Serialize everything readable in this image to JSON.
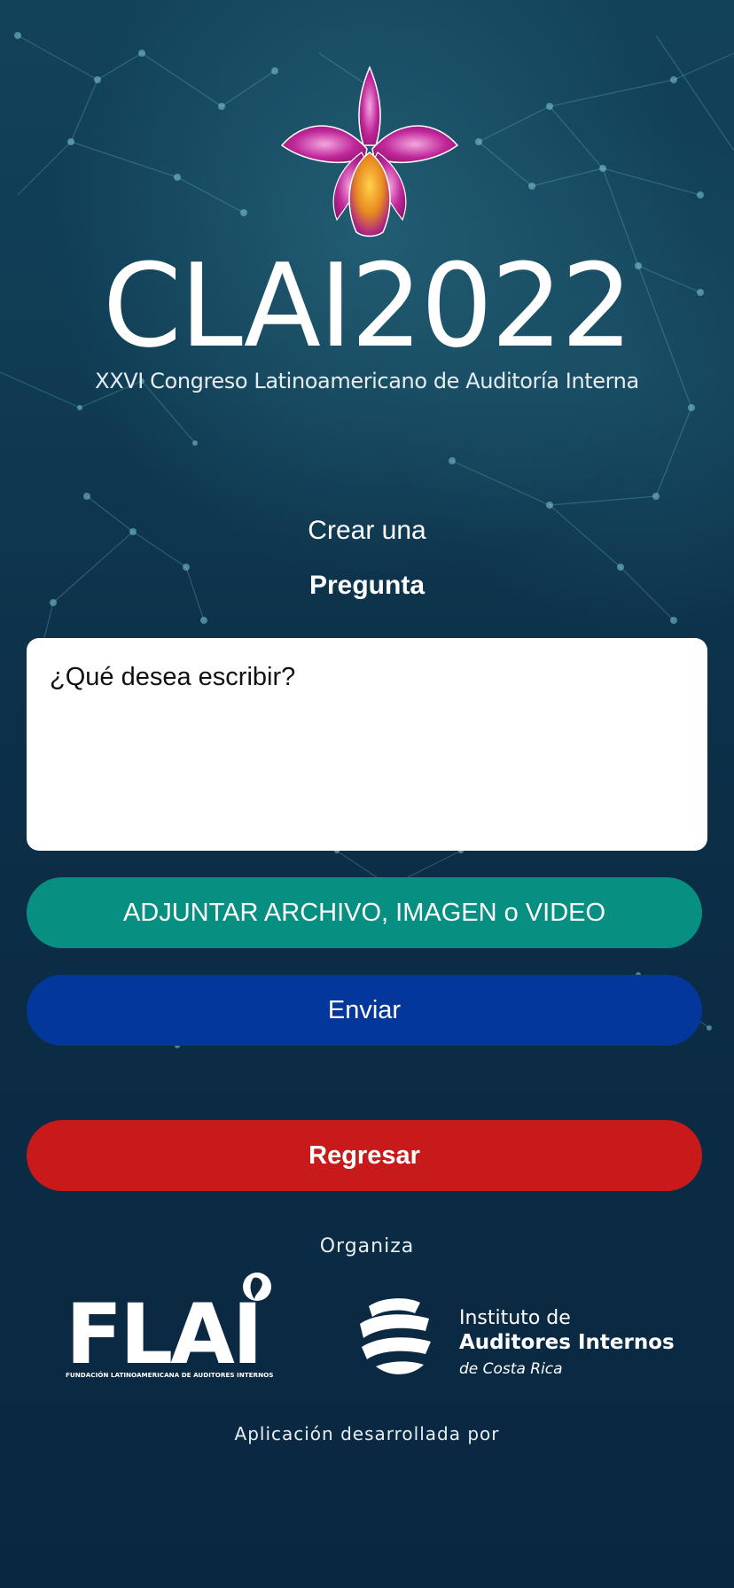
{
  "logo": {
    "title": "CLAI2022",
    "subtitle": "XXVI Congreso Latinoamericano de Auditoría Interna"
  },
  "heading": {
    "line1": "Crear una",
    "line2": "Pregunta"
  },
  "question": {
    "placeholder": "¿Qué desea escribir?",
    "value": ""
  },
  "buttons": {
    "attach_label": "ADJUNTAR ARCHIVO, IMAGEN o VIDEO",
    "send_label": "Enviar",
    "back_label": "Regresar"
  },
  "footer": {
    "organiza": "Organiza",
    "flai_name": "FLAI",
    "flai_full": "FUNDACIÓN LATINOAMERICANA DE AUDITORES INTERNOS",
    "iai_line1": "Instituto de",
    "iai_line2": "Auditores Internos",
    "iai_line3": "de Costa Rica",
    "developed_by": "Aplicación desarrollada por"
  },
  "colors": {
    "background": "#0b2a40",
    "attach_button": "#079081",
    "send_button": "#04379a",
    "back_button": "#c8191b",
    "orchid": "#c0279a"
  }
}
